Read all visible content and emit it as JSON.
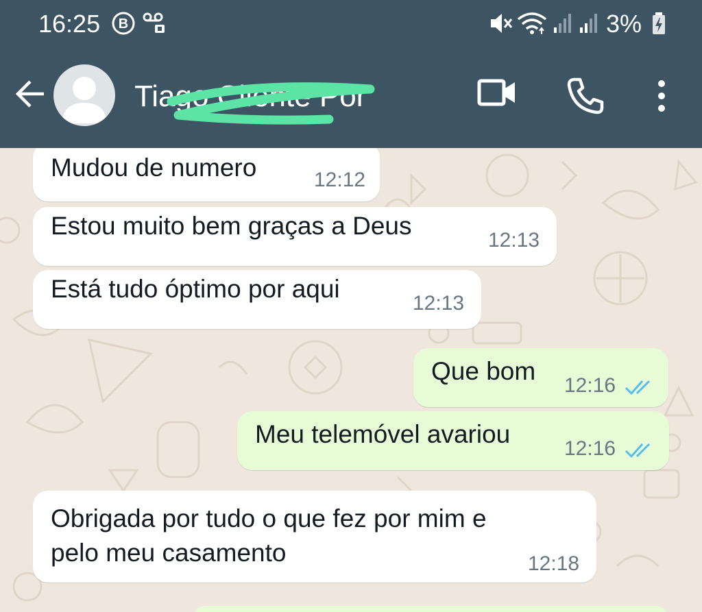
{
  "status_bar": {
    "time": "16:25",
    "battery_percent": "3%",
    "icons": [
      "business-b-icon",
      "voicemail-icon",
      "mute-icon",
      "wifi-icon",
      "signal-icon",
      "signal-icon",
      "charging-battery-icon"
    ]
  },
  "header": {
    "contact_name": "Tiago Cliente Por",
    "icons": [
      "back-arrow-icon",
      "avatar-icon",
      "video-call-icon",
      "phone-icon",
      "more-vert-icon"
    ],
    "bar_color": "#3d5563"
  },
  "messages": [
    {
      "direction": "in",
      "text": "Mudou de numero",
      "time": "12:12"
    },
    {
      "direction": "in",
      "text": "Estou muito bem graças a Deus",
      "time": "12:13"
    },
    {
      "direction": "in",
      "text": "Está tudo óptimo por aqui",
      "time": "12:13"
    },
    {
      "direction": "out",
      "text": "Que bom",
      "time": "12:16",
      "status": "read"
    },
    {
      "direction": "out",
      "text": "Meu telemóvel avariou",
      "time": "12:16",
      "status": "read"
    },
    {
      "direction": "in",
      "text_line1": "Obrigada por tudo o que fez por mim e",
      "text_line2": "pelo meu casamento",
      "time": "12:18"
    }
  ],
  "colors": {
    "incoming_bubble": "#ffffff",
    "outgoing_bubble": "#e7fcd6",
    "read_ticks": "#53bdeb",
    "chat_background": "#efe7de"
  }
}
